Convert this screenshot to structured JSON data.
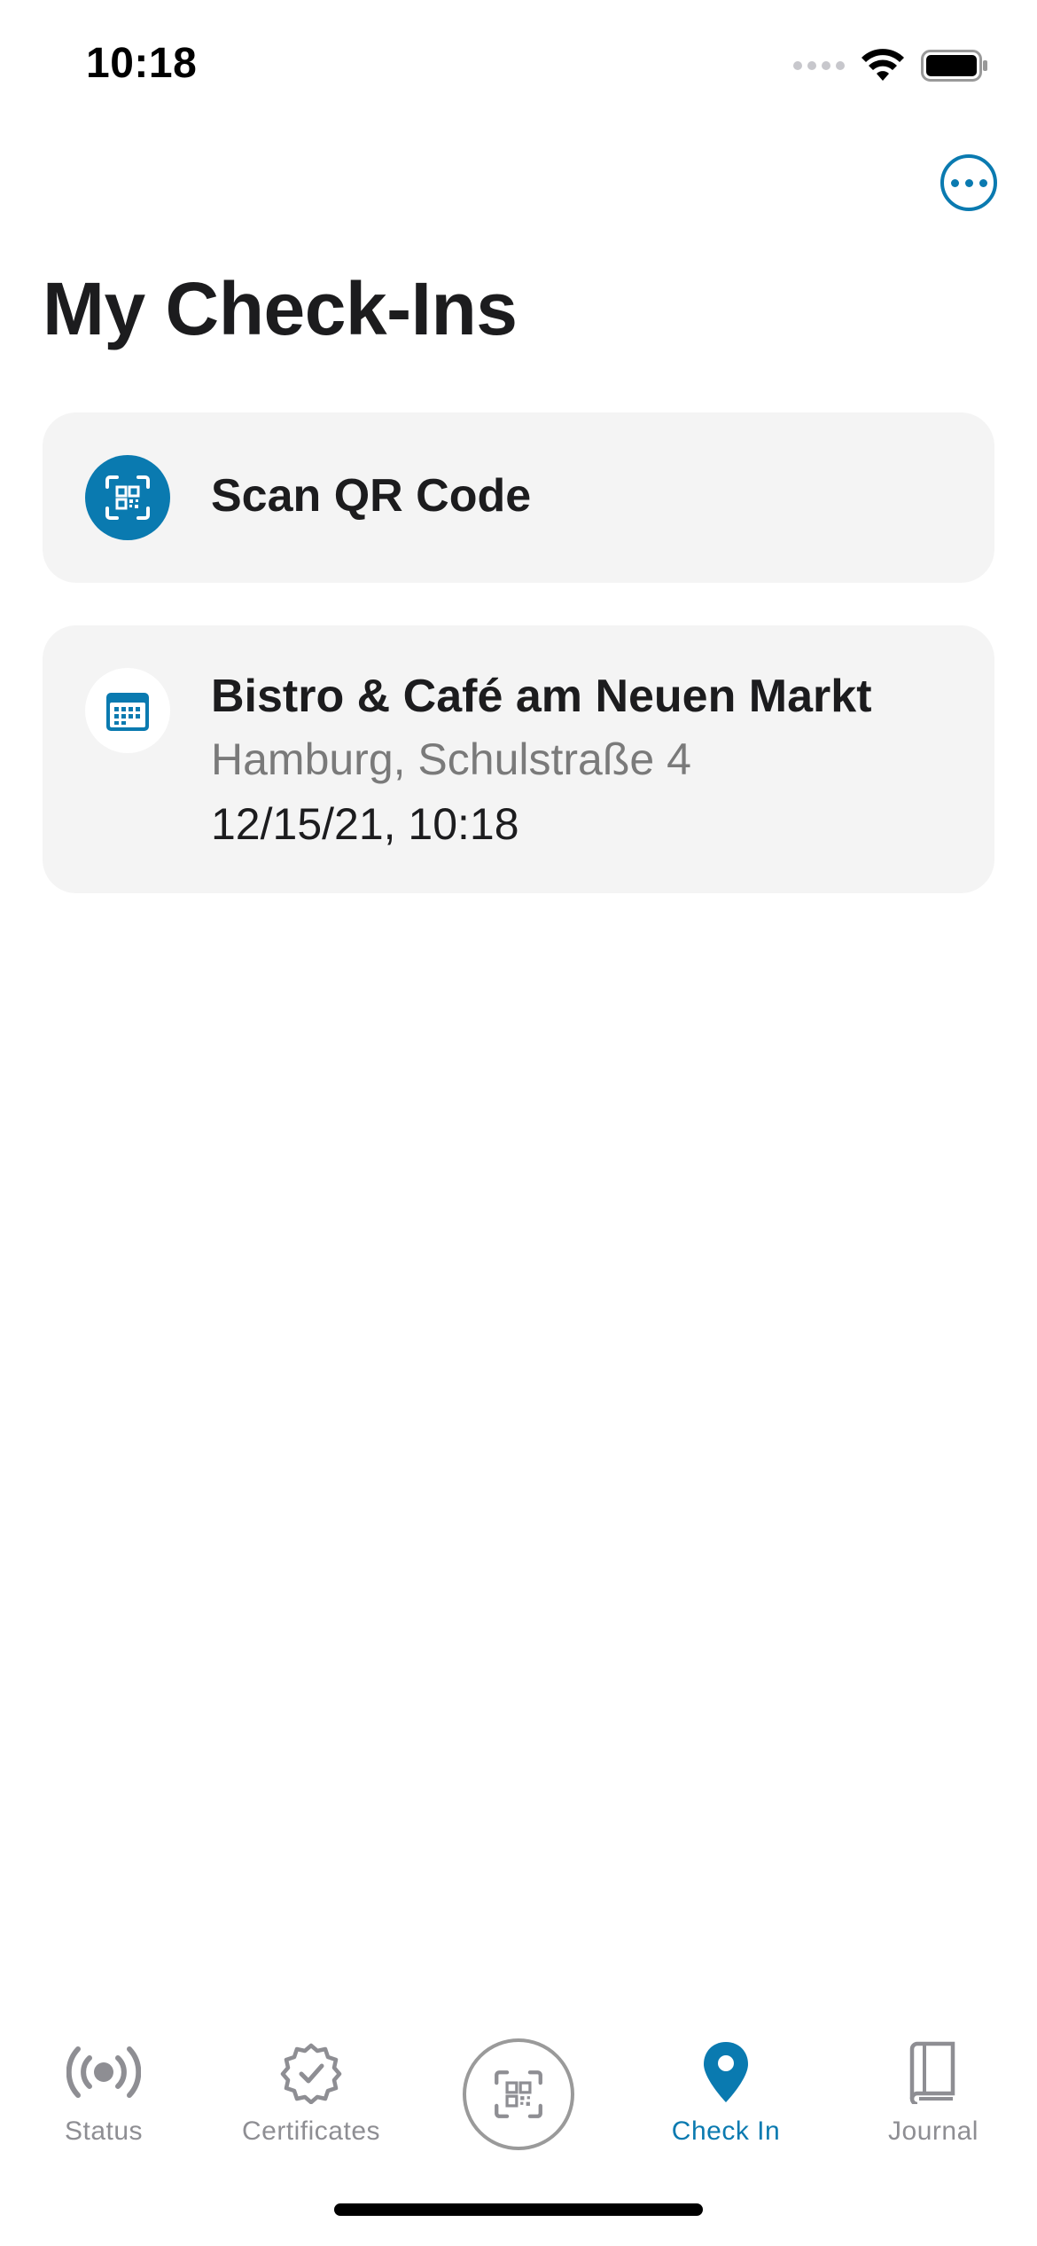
{
  "status_bar": {
    "time": "10:18"
  },
  "header": {
    "title": "My Check-Ins"
  },
  "scan_card": {
    "label": "Scan QR Code"
  },
  "checkins": [
    {
      "name": "Bistro & Café am Neuen Markt",
      "address": "Hamburg, Schulstraße 4",
      "datetime": "12/15/21, 10:18"
    }
  ],
  "tab_bar": {
    "tabs": [
      {
        "label": "Status",
        "icon": "status-icon",
        "active": false
      },
      {
        "label": "Certificates",
        "icon": "certificate-icon",
        "active": false
      },
      {
        "label": "",
        "icon": "qr-scan-icon",
        "active": false
      },
      {
        "label": "Check In",
        "icon": "location-pin-icon",
        "active": true
      },
      {
        "label": "Journal",
        "icon": "book-icon",
        "active": false
      }
    ]
  },
  "colors": {
    "accent": "#0a7ab0",
    "card_bg": "#f4f4f4",
    "inactive": "#8e8e93"
  }
}
